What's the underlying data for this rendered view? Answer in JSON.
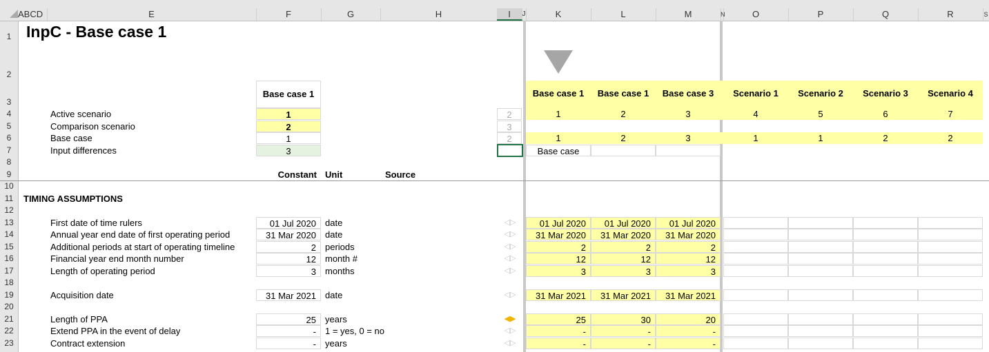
{
  "column_headers": {
    "abcd": "ABCD",
    "E": "E",
    "F": "F",
    "G": "G",
    "H": "H",
    "I": "I",
    "J": "J",
    "K": "K",
    "L": "L",
    "M": "M",
    "N": "N",
    "O": "O",
    "P": "P",
    "Q": "Q",
    "R": "R",
    "S": "S"
  },
  "row_numbers": [
    "1",
    "2",
    "3",
    "4",
    "5",
    "6",
    "7",
    "8",
    "9",
    "10",
    "11",
    "12",
    "13",
    "14",
    "15",
    "16",
    "17",
    "18",
    "19",
    "20",
    "21",
    "22",
    "23"
  ],
  "title": "InpC - Base case 1",
  "f_header": "Base case 1",
  "labels": {
    "active_scenario": "Active scenario",
    "comparison_scenario": "Comparison scenario",
    "base_case": "Base case",
    "input_differences": "Input differences"
  },
  "f_values": {
    "active": "1",
    "comparison": "2",
    "base": "1",
    "diff": "3"
  },
  "i_values": {
    "active": "2",
    "comparison": "3",
    "base": "2"
  },
  "scenario_headers": [
    "Base case 1",
    "Base case 1",
    "Base case 3",
    "Scenario 1",
    "Scenario 2",
    "Scenario 3",
    "Scenario 4"
  ],
  "scenario_row4": [
    "1",
    "2",
    "3",
    "4",
    "5",
    "6",
    "7"
  ],
  "scenario_row6": [
    "1",
    "2",
    "3",
    "1",
    "1",
    "2",
    "2"
  ],
  "k7_label": "Base case",
  "section_headers": {
    "constant": "Constant",
    "unit": "Unit",
    "source": "Source"
  },
  "timing_title": "TIMING ASSUMPTIONS",
  "rows": [
    {
      "label": "First date of time rulers",
      "value": "01 Jul 2020",
      "unit": "date",
      "k": "01 Jul 2020",
      "l": "01 Jul 2020",
      "m": "01 Jul 2020"
    },
    {
      "label": "Annual year end date of first operating period",
      "value": "31 Mar 2020",
      "unit": "date",
      "k": "31 Mar 2020",
      "l": "31 Mar 2020",
      "m": "31 Mar 2020"
    },
    {
      "label": "Additional periods at start of operating timeline",
      "value": "2",
      "unit": "periods",
      "k": "2",
      "l": "2",
      "m": "2"
    },
    {
      "label": "Financial year end month number",
      "value": "12",
      "unit": "month #",
      "k": "12",
      "l": "12",
      "m": "12"
    },
    {
      "label": "Length of operating period",
      "value": "3",
      "unit": "months",
      "k": "3",
      "l": "3",
      "m": "3"
    },
    {
      "label": "Acquisition date",
      "value": "31 Mar 2021",
      "unit": "date",
      "k": "31 Mar 2021",
      "l": "31 Mar 2021",
      "m": "31 Mar 2021"
    },
    {
      "label": "Length of PPA",
      "value": "25",
      "unit": "years",
      "k": "25",
      "l": "30",
      "m": "20"
    },
    {
      "label": "Extend PPA in the event of delay",
      "value": "-",
      "unit": "1 = yes, 0 = no",
      "k": "-",
      "l": "-",
      "m": "-"
    },
    {
      "label": "Contract extension",
      "value": "-",
      "unit": "years",
      "k": "-",
      "l": "-",
      "m": "-"
    }
  ],
  "colors": {
    "yellow": "#ffffa6",
    "green": "#e6f2e0",
    "header_gray": "#e6e6e6",
    "arrow_active": "#f0b400"
  }
}
